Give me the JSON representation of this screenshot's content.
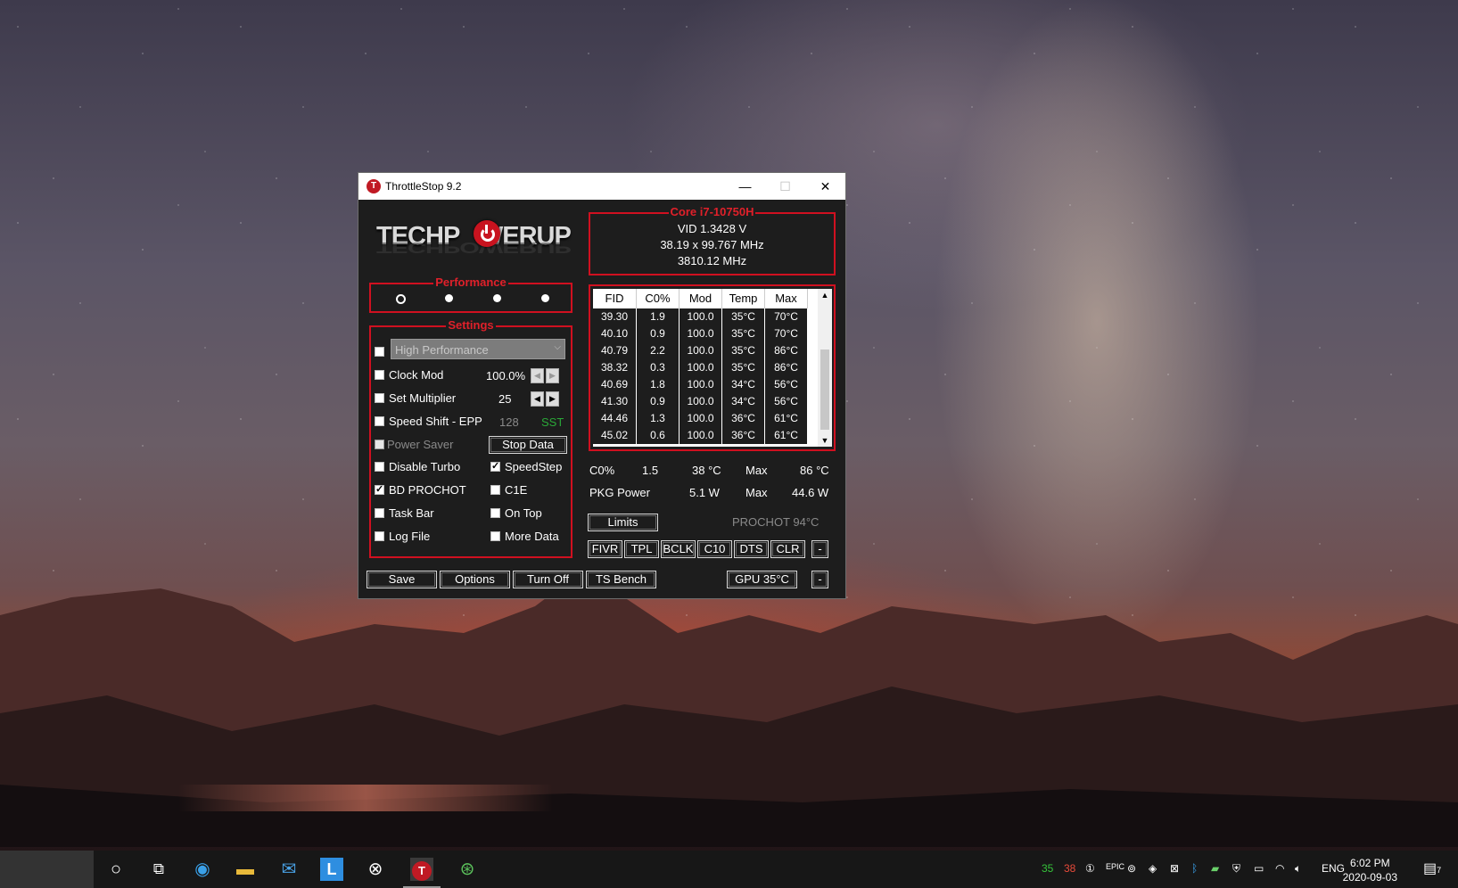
{
  "window": {
    "title": "ThrottleStop 9.2",
    "minimize": "—",
    "maximize": "☐",
    "close": "✕"
  },
  "logo": {
    "text": "TECHPOWERUP"
  },
  "performance": {
    "title": "Performance",
    "selected_profile": 1
  },
  "settings": {
    "title": "Settings",
    "profile_combo": "High Performance",
    "clock_mod": {
      "label": "Clock Mod",
      "value": "100.0%"
    },
    "set_multiplier": {
      "label": "Set Multiplier",
      "value": "25"
    },
    "speed_shift": {
      "label": "Speed Shift - EPP",
      "value": "128",
      "tag": "SST"
    },
    "power_saver": {
      "label": "Power Saver"
    },
    "stop_data": "Stop Data",
    "disable_turbo": "Disable Turbo",
    "speedstep": "SpeedStep",
    "bd_prochot": "BD PROCHOT",
    "c1e": "C1E",
    "task_bar": "Task Bar",
    "on_top": "On Top",
    "log_file": "Log File",
    "more_data": "More Data"
  },
  "bottom_buttons": {
    "save": "Save",
    "options": "Options",
    "turn_off": "Turn Off",
    "ts_bench": "TS Bench",
    "gpu": "GPU 35°C",
    "minus": "-"
  },
  "core": {
    "title": "Core i7-10750H",
    "vid": "VID  1.3428 V",
    "multiplier": "38.19 x 99.767 MHz",
    "freq": "3810.12 MHz"
  },
  "table": {
    "headers": [
      "FID",
      "C0%",
      "Mod",
      "Temp",
      "Max"
    ],
    "rows": [
      [
        "39.30",
        "1.9",
        "100.0",
        "35°C",
        "70°C"
      ],
      [
        "40.10",
        "0.9",
        "100.0",
        "35°C",
        "70°C"
      ],
      [
        "40.79",
        "2.2",
        "100.0",
        "35°C",
        "86°C"
      ],
      [
        "38.32",
        "0.3",
        "100.0",
        "35°C",
        "86°C"
      ],
      [
        "40.69",
        "1.8",
        "100.0",
        "34°C",
        "56°C"
      ],
      [
        "41.30",
        "0.9",
        "100.0",
        "34°C",
        "56°C"
      ],
      [
        "44.46",
        "1.3",
        "100.0",
        "36°C",
        "61°C"
      ],
      [
        "45.02",
        "0.6",
        "100.0",
        "36°C",
        "61°C"
      ]
    ]
  },
  "stats": {
    "c0_label": "C0%",
    "c0_value": "1.5",
    "c0_temp": "38 °C",
    "c0_max_label": "Max",
    "c0_max": "86 °C",
    "pkg_label": "PKG Power",
    "pkg_value": "5.1 W",
    "pkg_max_label": "Max",
    "pkg_max": "44.6 W",
    "limits": "Limits",
    "prochot": "PROCHOT 94°C"
  },
  "tools": [
    "FIVR",
    "TPL",
    "BCLK",
    "C10",
    "DTS",
    "CLR"
  ],
  "tools_minus": "-",
  "taskbar": {
    "tray_temp1": "35",
    "tray_temp2": "38",
    "lang": "ENG",
    "time": "6:02 PM",
    "date": "2020-09-03",
    "notif_count": "7",
    "colors": {
      "temp1": "#35c43a",
      "temp2": "#e84a3a"
    }
  }
}
